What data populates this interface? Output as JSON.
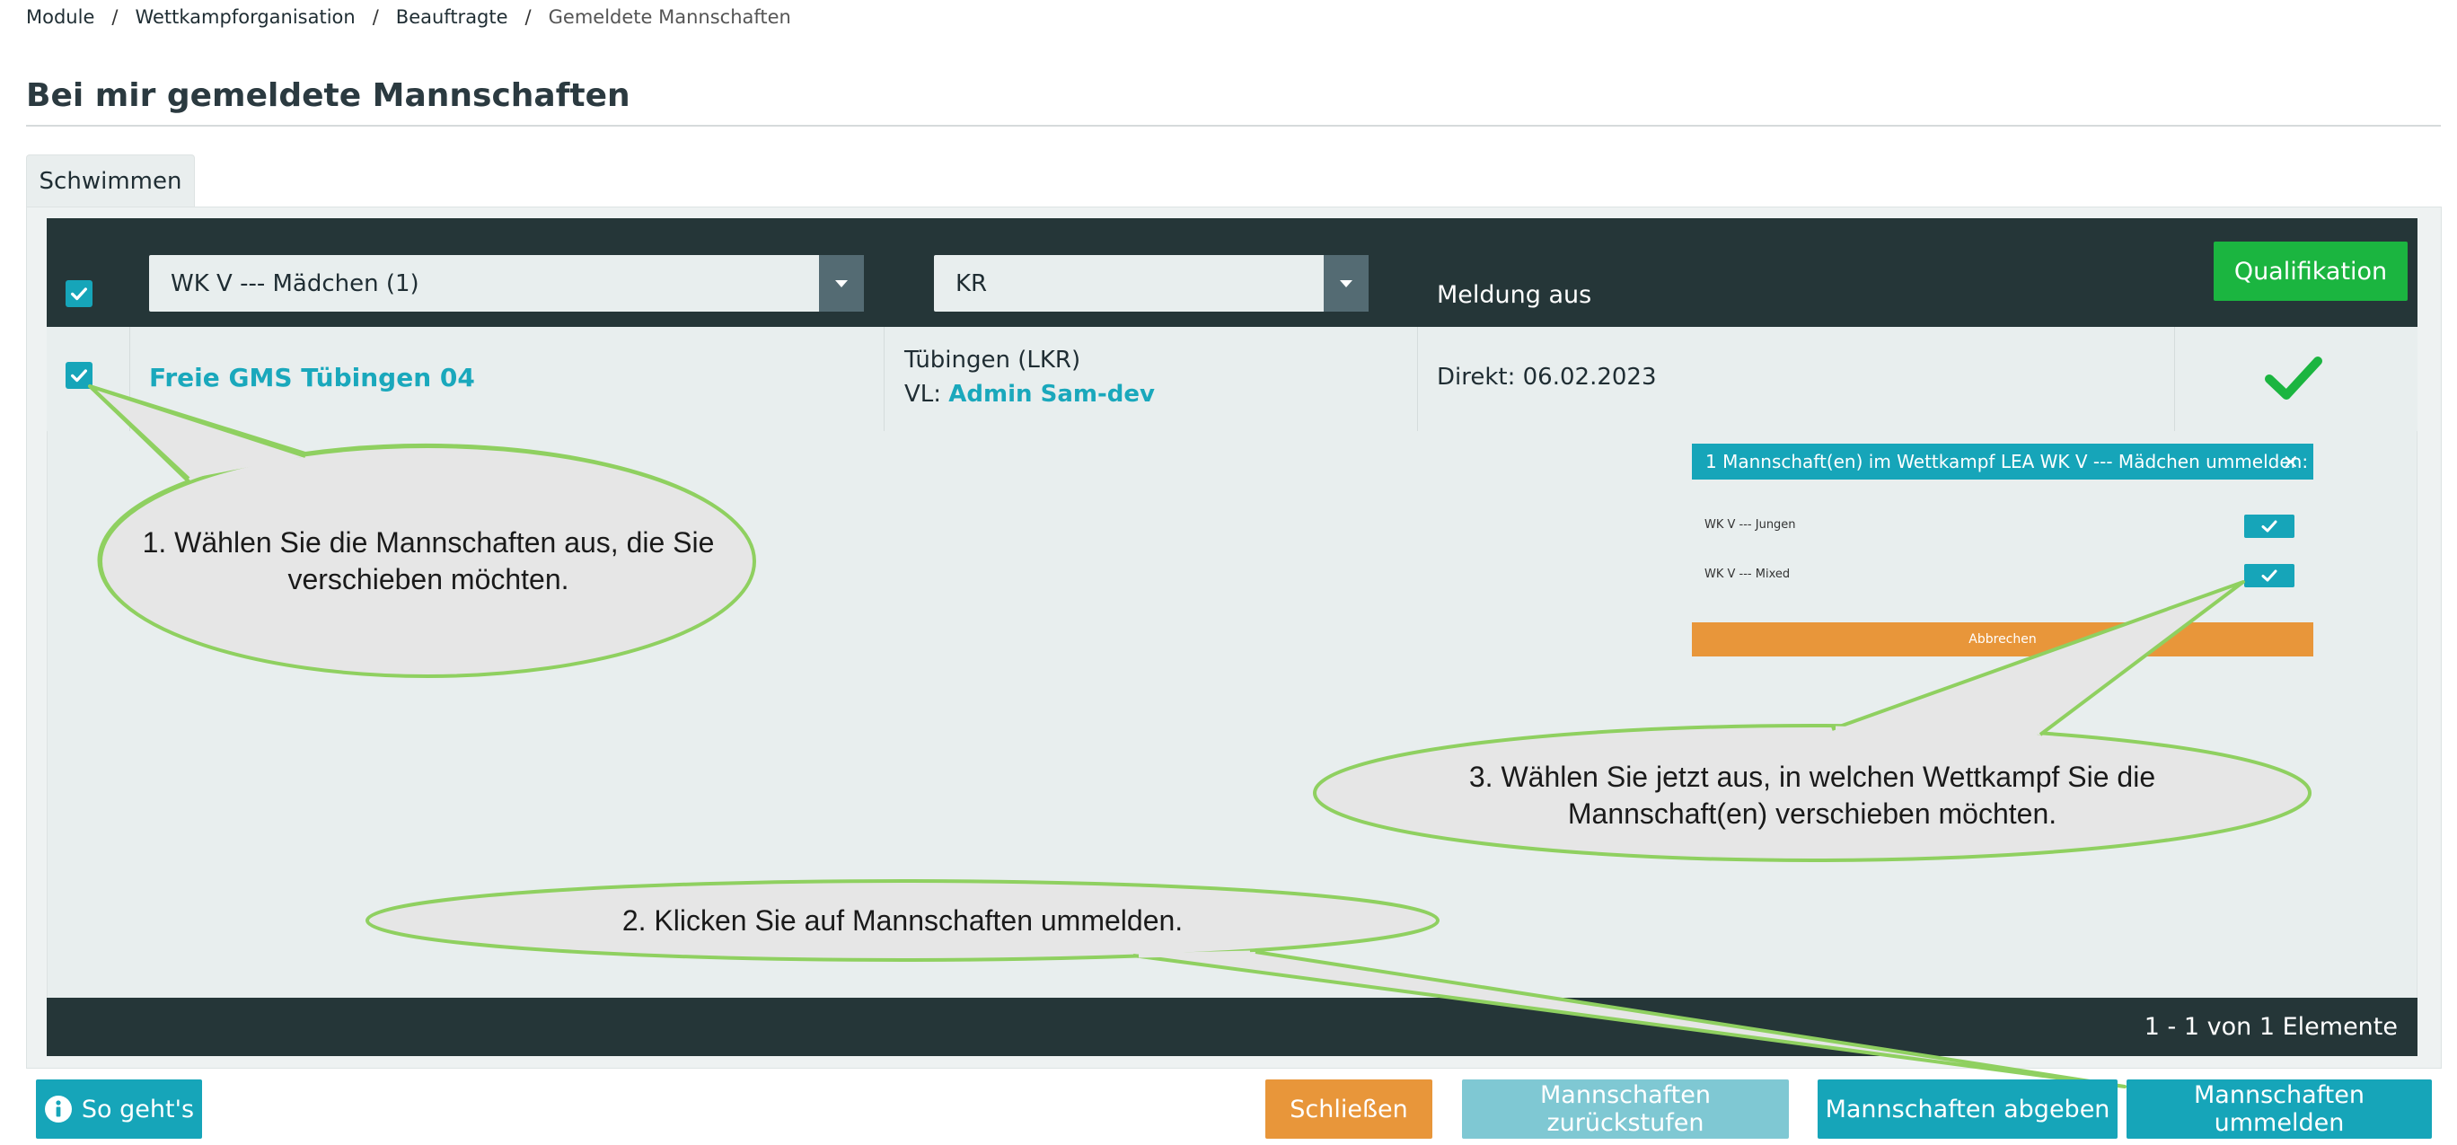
{
  "breadcrumb": [
    "Module",
    "Wettkampforganisation",
    "Beauftragte",
    "Gemeldete Mannschaften"
  ],
  "breadcrumb_separator": "/",
  "page_title": "Bei mir gemeldete Mannschaften",
  "tabs": [
    {
      "label": "Schwimmen",
      "active": true
    }
  ],
  "grid": {
    "filters": {
      "competition": "WK V --- Mädchen (1)",
      "district": "KR"
    },
    "column_meldung": "Meldung aus",
    "qualification_button": "Qualifikation",
    "rows": [
      {
        "checked": true,
        "team": "Freie GMS Tübingen 04",
        "region": "Tübingen (LKR)",
        "vl_prefix": "VL:",
        "vl_name": "Admin Sam-dev",
        "meldung": "Direkt: 06.02.2023",
        "qualified": true
      }
    ],
    "pager": "1 - 1 von 1 Elemente"
  },
  "dialog": {
    "title": "1 Mannschaft(en) im Wettkampf LEA WK V --- Mädchen ummelden:",
    "close": "×",
    "options": [
      {
        "label": "WK V --- Jungen",
        "checked": true
      },
      {
        "label": "WK V --- Mixed",
        "checked": true
      }
    ],
    "cancel": "Abbrechen"
  },
  "callouts": {
    "step1_line1": "1. Wählen Sie die Mannschaften aus, die Sie",
    "step1_line2": "verschieben möchten.",
    "step2": "2. Klicken Sie auf Mannschaften ummelden.",
    "step3_line1": "3. Wählen Sie jetzt aus, in welchen Wettkampf Sie die",
    "step3_line2": "Mannschaft(en) verschieben möchten."
  },
  "footer_buttons": {
    "help": "So geht's",
    "close": "Schließen",
    "downgrade": "Mannschaften zurückstufen",
    "hand_over": "Mannschaften abgeben",
    "reassign": "Mannschaften ummelden"
  },
  "colors": {
    "teal": "#16a5b9",
    "dark_header": "#253638",
    "green": "#1bb540",
    "orange": "#e8963a",
    "callout_stroke": "#8fd060",
    "callout_fill": "#e6e6e6"
  }
}
